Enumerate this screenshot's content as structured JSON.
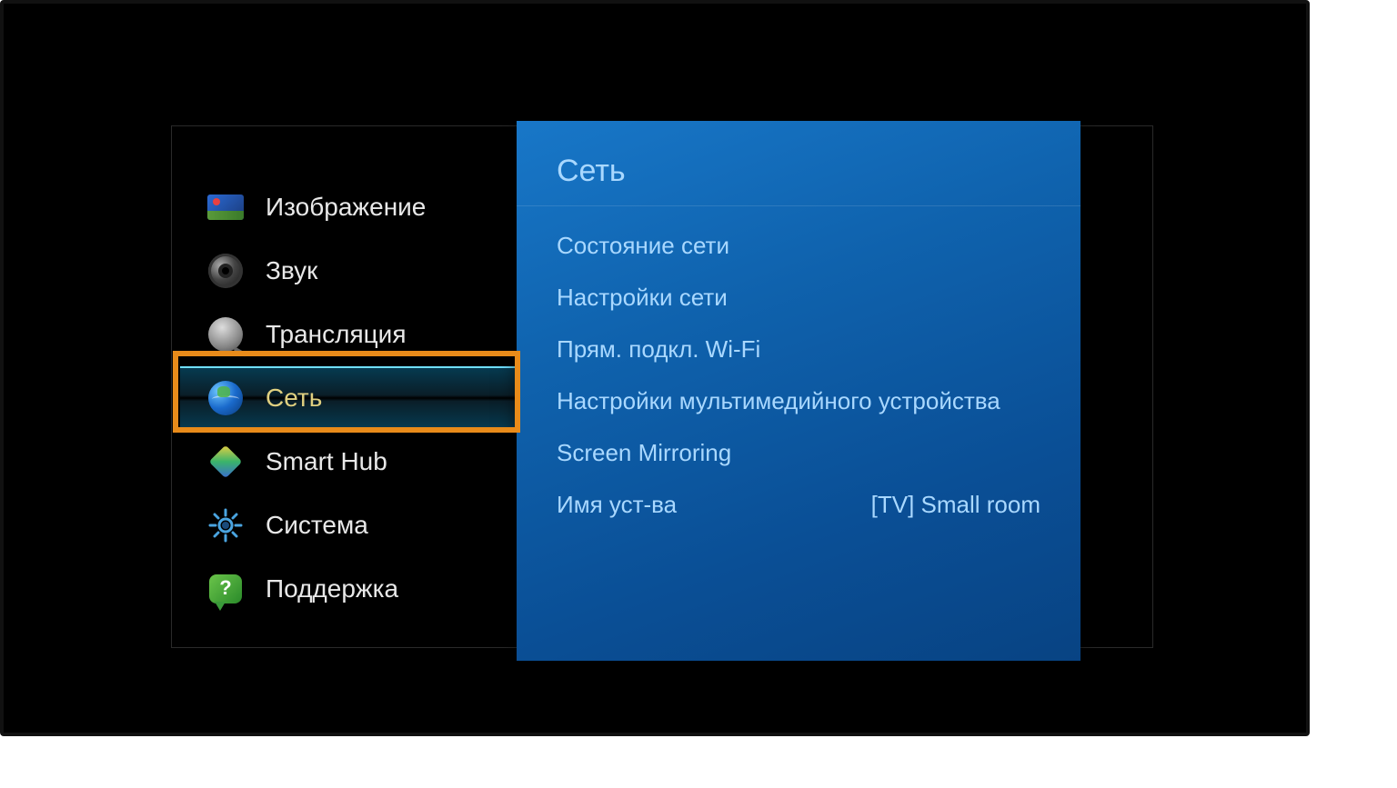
{
  "sidebar": {
    "items": [
      {
        "label": "Изображение",
        "icon": "picture-icon"
      },
      {
        "label": "Звук",
        "icon": "sound-icon"
      },
      {
        "label": "Трансляция",
        "icon": "broadcast-icon"
      },
      {
        "label": "Сеть",
        "icon": "network-icon"
      },
      {
        "label": "Smart Hub",
        "icon": "smarthub-icon"
      },
      {
        "label": "Система",
        "icon": "system-icon"
      },
      {
        "label": "Поддержка",
        "icon": "support-icon"
      }
    ],
    "selected_index": 3
  },
  "detail": {
    "title": "Сеть",
    "items": [
      {
        "label": "Состояние сети",
        "value": ""
      },
      {
        "label": "Настройки сети",
        "value": ""
      },
      {
        "label": "Прям. подкл. Wi-Fi",
        "value": ""
      },
      {
        "label": "Настройки мультимедийного устройства",
        "value": ""
      },
      {
        "label": "Screen Mirroring",
        "value": ""
      },
      {
        "label": "Имя уст-ва",
        "value": "[TV] Small room"
      }
    ]
  },
  "colors": {
    "highlight_border": "#e88b1a",
    "panel_blue": "#0f62ad",
    "text_blue": "#a9d8ff"
  }
}
